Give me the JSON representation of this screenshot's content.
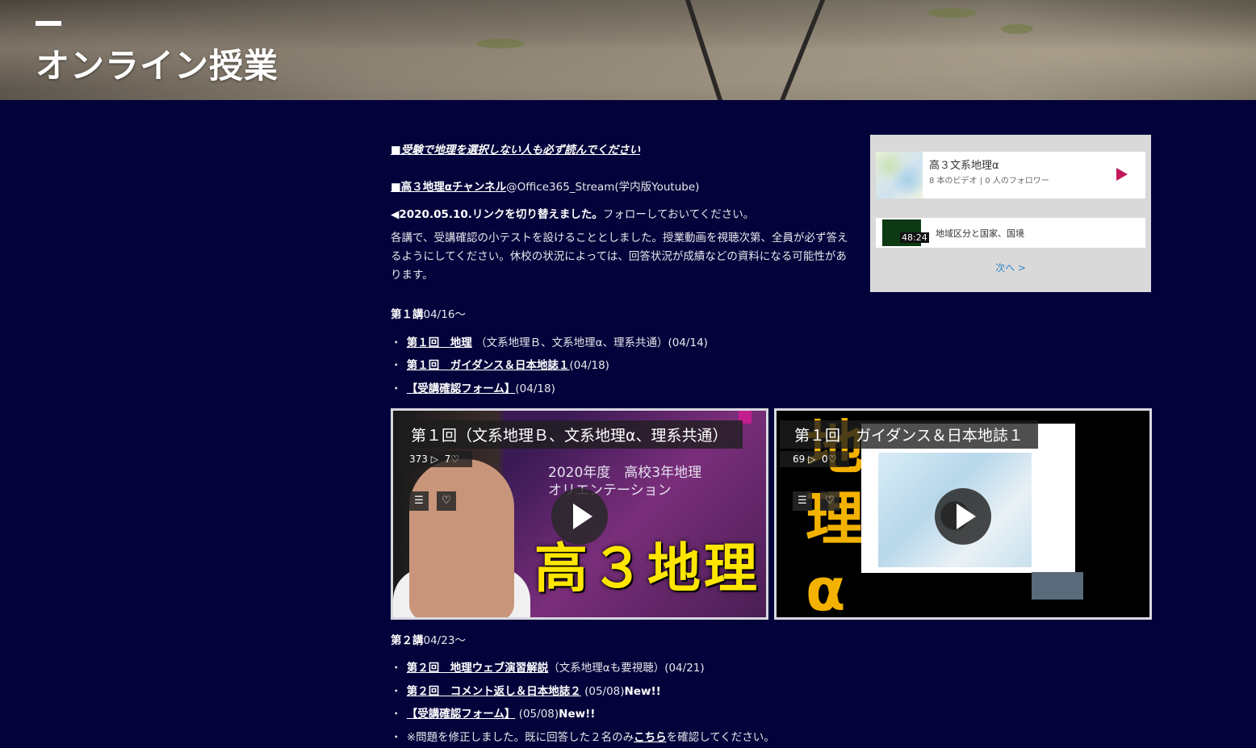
{
  "header": {
    "title": "オンライン授業"
  },
  "content": {
    "notice": "■受験で地理を選択しない人も必ず読んでください",
    "channel_link": "■高３地理αチャンネル",
    "channel_suffix": "@Office365_Stream(学内版Youtube)",
    "switch_bold": "◀2020.05.10.リンクを切り替えました。",
    "switch_rest": "フォローしておいてください。",
    "paragraph": "各講で、受講確認の小テストを設けることとしました。授業動画を視聴次第、全員が必ず答えるようにしてください。休校の状況によっては、回答状況が成績などの資料になる可能性があります。",
    "lecture1": {
      "heading": "第１講",
      "date": "04/16〜",
      "items": [
        {
          "link": "第１回　地理",
          "rest": "（文系地理Ｂ、文系地理α、理系共通）(04/14)"
        },
        {
          "link": "第１回　ガイダンス＆日本地誌１",
          "rest": "(04/18)"
        },
        {
          "link": "【受講確認フォーム】",
          "rest": "(04/18)"
        }
      ]
    },
    "lecture2": {
      "heading": "第２講",
      "date": "04/23〜",
      "items": [
        {
          "link": "第２回　地理ウェブ演習解説",
          "rest": "（文系地理αも要視聴）(04/21)",
          "new": ""
        },
        {
          "link": "第２回　コメント返し＆日本地誌２",
          "rest": "(05/08)",
          "new": "New!!"
        },
        {
          "link": "【受講確認フォーム】",
          "rest": "(05/08)",
          "new": "New!!"
        }
      ],
      "note_before": "※問題を修正しました。既に回答した２名のみ",
      "note_link": "こちら",
      "note_after": "を確認してください。"
    }
  },
  "widget": {
    "channel_title": "高３文系地理α",
    "channel_sub": "8 本のビデオ | 0 人のフォロワー",
    "video_duration": "48:24",
    "video_title": "地域区分と国家、国境",
    "next_label": "次へ >"
  },
  "videos": [
    {
      "title": "第１回（文系地理Ｂ、文系地理α、理系共通）",
      "views": "373",
      "likes": "7",
      "slide_line1": "2020年度　高校3年地理",
      "slide_line2": "オリエンテーション",
      "big_text": "高３地理"
    },
    {
      "title": "第１回　ガイダンス＆日本地誌１",
      "views": "69",
      "likes": "0",
      "side_text": "地理α"
    }
  ],
  "colors": {
    "background": "#03023a",
    "widget_bg": "#d9d9d9",
    "play_accent": "#c2185b",
    "link_blue": "#2f86c9",
    "yellow": "#ffe600"
  }
}
